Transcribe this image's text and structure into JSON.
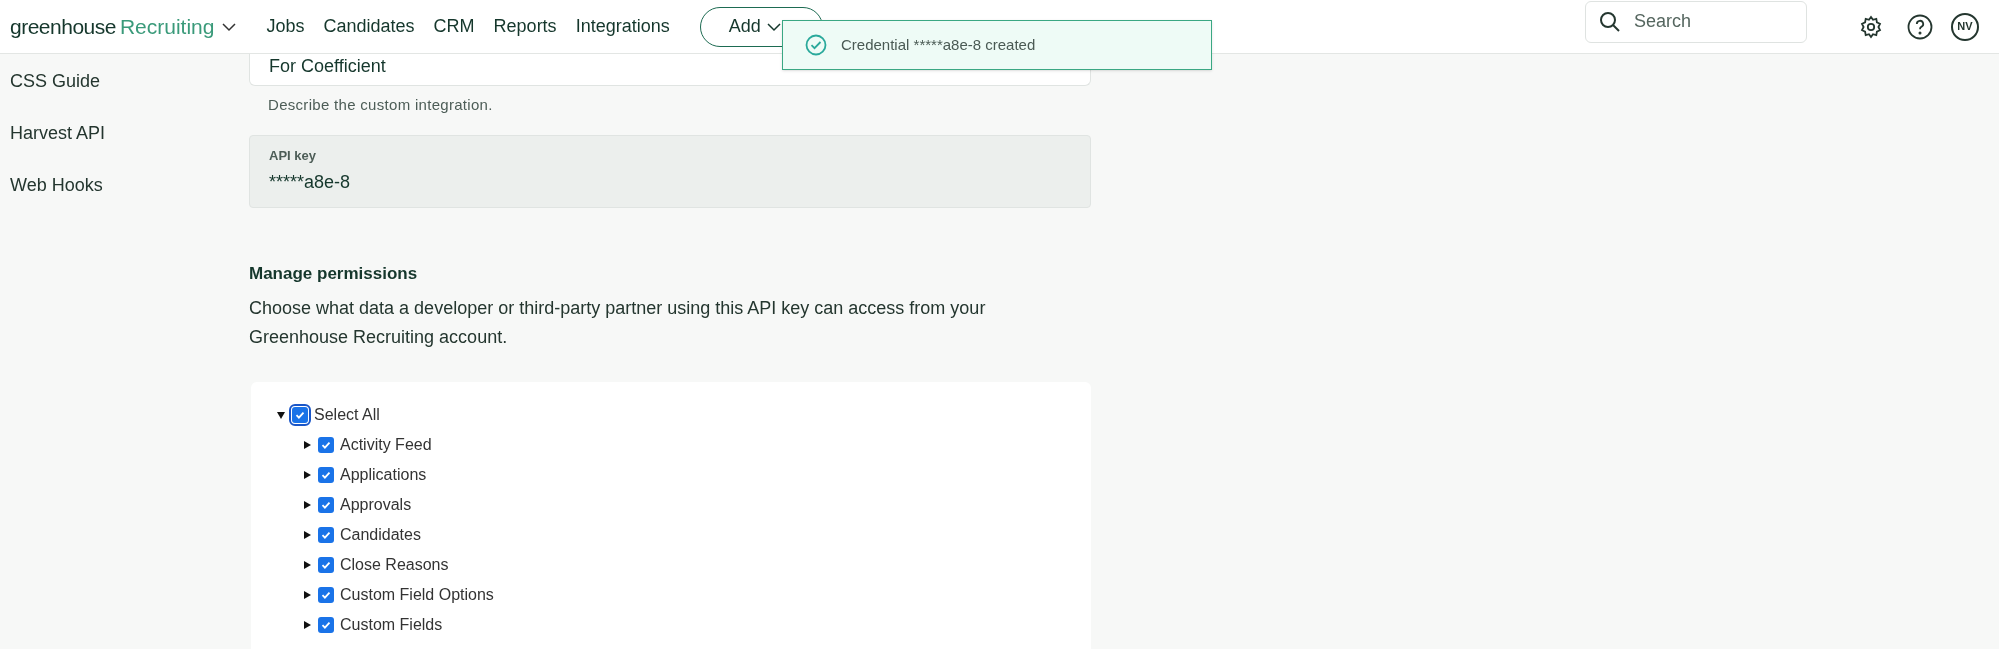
{
  "header": {
    "logo": {
      "brand": "greenhouse",
      "product": "Recruiting"
    },
    "nav": [
      "Jobs",
      "Candidates",
      "CRM",
      "Reports",
      "Integrations"
    ],
    "add_button": "Add",
    "search": {
      "placeholder": "Search"
    },
    "avatar": "NV"
  },
  "toast": {
    "message": "Credential *****a8e-8 created"
  },
  "sidebar": {
    "items": [
      "CSS Guide",
      "Harvest API",
      "Web Hooks"
    ]
  },
  "description_field": {
    "value": "For Coefficient",
    "hint": "Describe the custom integration."
  },
  "api_key": {
    "label": "API key",
    "value": "*****a8e-8"
  },
  "permissions": {
    "title": "Manage permissions",
    "description": "Choose what data a developer or third-party partner using this API key can access from your Greenhouse Recruiting account.",
    "tree": [
      {
        "label": "Select All",
        "checked": true,
        "expanded": true,
        "children": [
          {
            "label": "Activity Feed",
            "checked": true,
            "expanded": false
          },
          {
            "label": "Applications",
            "checked": true,
            "expanded": false
          },
          {
            "label": "Approvals",
            "checked": true,
            "expanded": false
          },
          {
            "label": "Candidates",
            "checked": true,
            "expanded": false
          },
          {
            "label": "Close Reasons",
            "checked": true,
            "expanded": false
          },
          {
            "label": "Custom Field Options",
            "checked": true,
            "expanded": false
          },
          {
            "label": "Custom Fields",
            "checked": true,
            "expanded": false
          }
        ]
      }
    ]
  }
}
